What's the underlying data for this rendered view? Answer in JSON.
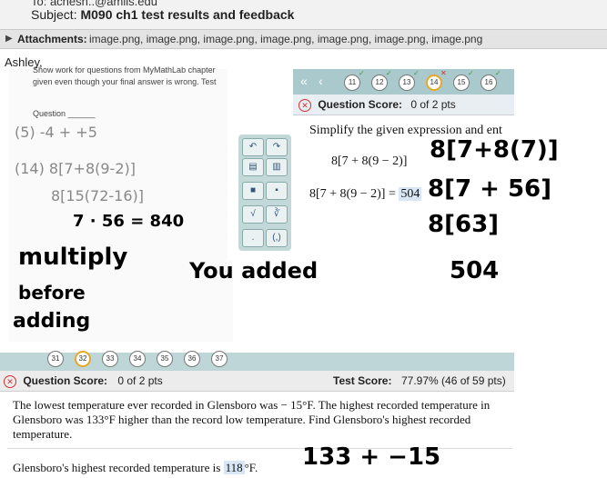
{
  "email": {
    "to_partial": "To: achesh..@amiis.edu",
    "subject_label": "Subject:",
    "subject": "M090 ch1 test results and feedback",
    "attachments_label": "Attachments:",
    "attachments": "image.png, image.png, image.png, image.png, image.png, image.png, image.png",
    "greeting": "Ashley,"
  },
  "paper": {
    "line1": "Show work for questions from MyMathLab chapter",
    "line2": "given even though your final answer is wrong.  Test",
    "question_label": "Question ______",
    "work": [
      "(5)  -4 + +5",
      "(14)  8[7+8(9-2)]",
      "8[15(72-16)]",
      "7 · 56 = 840"
    ]
  },
  "mymathlab": {
    "question_numbers": [
      "11",
      "12",
      "13",
      "14",
      "15",
      "16"
    ],
    "current": "14",
    "question_score_label": "Question Score:",
    "question_score": "0 of 2 pts",
    "prompt": "Simplify the given expression and ent",
    "expression": "8[7 + 8(9 − 2)]",
    "answer_lhs": "8[7 + 8(9 − 2)] =",
    "answer": "504"
  },
  "feedback": {
    "ink_lines": [
      "8[7+8(7)]",
      "8[7 + 56]",
      "8[63]",
      "504"
    ],
    "notes": [
      "multiply",
      "before",
      "adding"
    ],
    "you_added": "You added"
  },
  "question2": {
    "strip_numbers": [
      "31",
      "32",
      "33",
      "34",
      "35",
      "36",
      "37"
    ],
    "question_score_label": "Question Score:",
    "question_score": "0 of 2 pts",
    "test_score_label": "Test Score:",
    "test_score": "77.97% (46 of 59 pts)",
    "text": "The lowest temperature ever recorded in Glensboro was − 15°F.  The highest recorded temperature in Glensboro was 133°F higher than the record low temperature.  Find Glensboro's highest recorded temperature.",
    "answer_prefix": "Glensboro's highest recorded temperature is",
    "answer": "118",
    "answer_suffix": "°F.",
    "ink": "133 + −15"
  }
}
